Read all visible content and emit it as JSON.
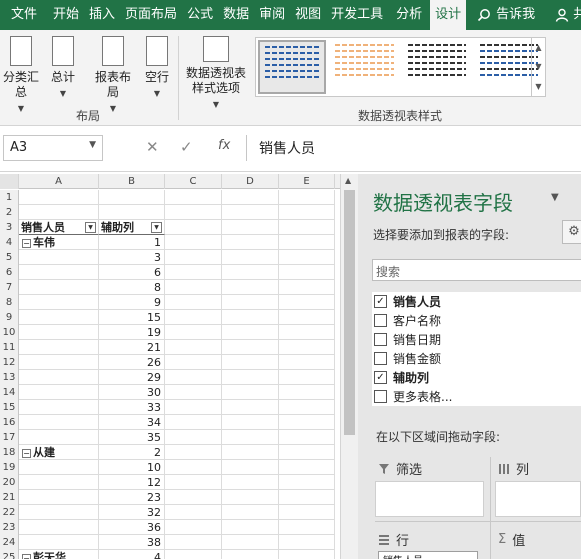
{
  "ribbon_tabs": [
    "文件",
    "开始",
    "插入",
    "页面布局",
    "公式",
    "数据",
    "审阅",
    "视图",
    "开发工具",
    "分析",
    "设计"
  ],
  "search_tab": "告诉我",
  "user_label": "共",
  "ribbon": {
    "subtotals": "分类汇总",
    "grand_totals": "总计",
    "report_layout": "报表布局",
    "blank_rows": "空行",
    "layout_group": "布局",
    "style_options": "数据透视表样式选项",
    "styles_group": "数据透视表样式"
  },
  "formula_bar": {
    "name_box": "A3",
    "fx": "fx",
    "formula": "销售人员"
  },
  "grid": {
    "columns": [
      "A",
      "B",
      "C",
      "D",
      "E"
    ],
    "rows": [
      {
        "n": "1",
        "a": "",
        "b": ""
      },
      {
        "n": "2",
        "a": "",
        "b": ""
      },
      {
        "n": "3",
        "a": "销售人员",
        "b": "辅助列"
      },
      {
        "n": "4",
        "a": "车伟",
        "b": "1"
      },
      {
        "n": "5",
        "a": "",
        "b": "3"
      },
      {
        "n": "6",
        "a": "",
        "b": "6"
      },
      {
        "n": "7",
        "a": "",
        "b": "8"
      },
      {
        "n": "8",
        "a": "",
        "b": "9"
      },
      {
        "n": "9",
        "a": "",
        "b": "15"
      },
      {
        "n": "10",
        "a": "",
        "b": "19"
      },
      {
        "n": "11",
        "a": "",
        "b": "21"
      },
      {
        "n": "12",
        "a": "",
        "b": "26"
      },
      {
        "n": "13",
        "a": "",
        "b": "29"
      },
      {
        "n": "14",
        "a": "",
        "b": "30"
      },
      {
        "n": "15",
        "a": "",
        "b": "33"
      },
      {
        "n": "16",
        "a": "",
        "b": "34"
      },
      {
        "n": "17",
        "a": "",
        "b": "35"
      },
      {
        "n": "18",
        "a": "从建",
        "b": "2"
      },
      {
        "n": "19",
        "a": "",
        "b": "10"
      },
      {
        "n": "20",
        "a": "",
        "b": "12"
      },
      {
        "n": "21",
        "a": "",
        "b": "23"
      },
      {
        "n": "22",
        "a": "",
        "b": "32"
      },
      {
        "n": "23",
        "a": "",
        "b": "36"
      },
      {
        "n": "24",
        "a": "",
        "b": "38"
      },
      {
        "n": "25",
        "a": "彭天华",
        "b": "4"
      }
    ]
  },
  "pane": {
    "title": "数据透视表字段",
    "subtitle": "选择要添加到报表的字段:",
    "search_placeholder": "搜索",
    "fields": [
      {
        "label": "销售人员",
        "checked": true
      },
      {
        "label": "客户名称",
        "checked": false
      },
      {
        "label": "销售日期",
        "checked": false
      },
      {
        "label": "销售金额",
        "checked": false
      },
      {
        "label": "辅助列",
        "checked": true
      },
      {
        "label": "更多表格...",
        "checked": false
      }
    ],
    "areas_label": "在以下区域间拖动字段:",
    "filter_label": "筛选",
    "columns_label": "列",
    "rows_label": "行",
    "values_label": "值",
    "row_chip": "销售人员"
  }
}
